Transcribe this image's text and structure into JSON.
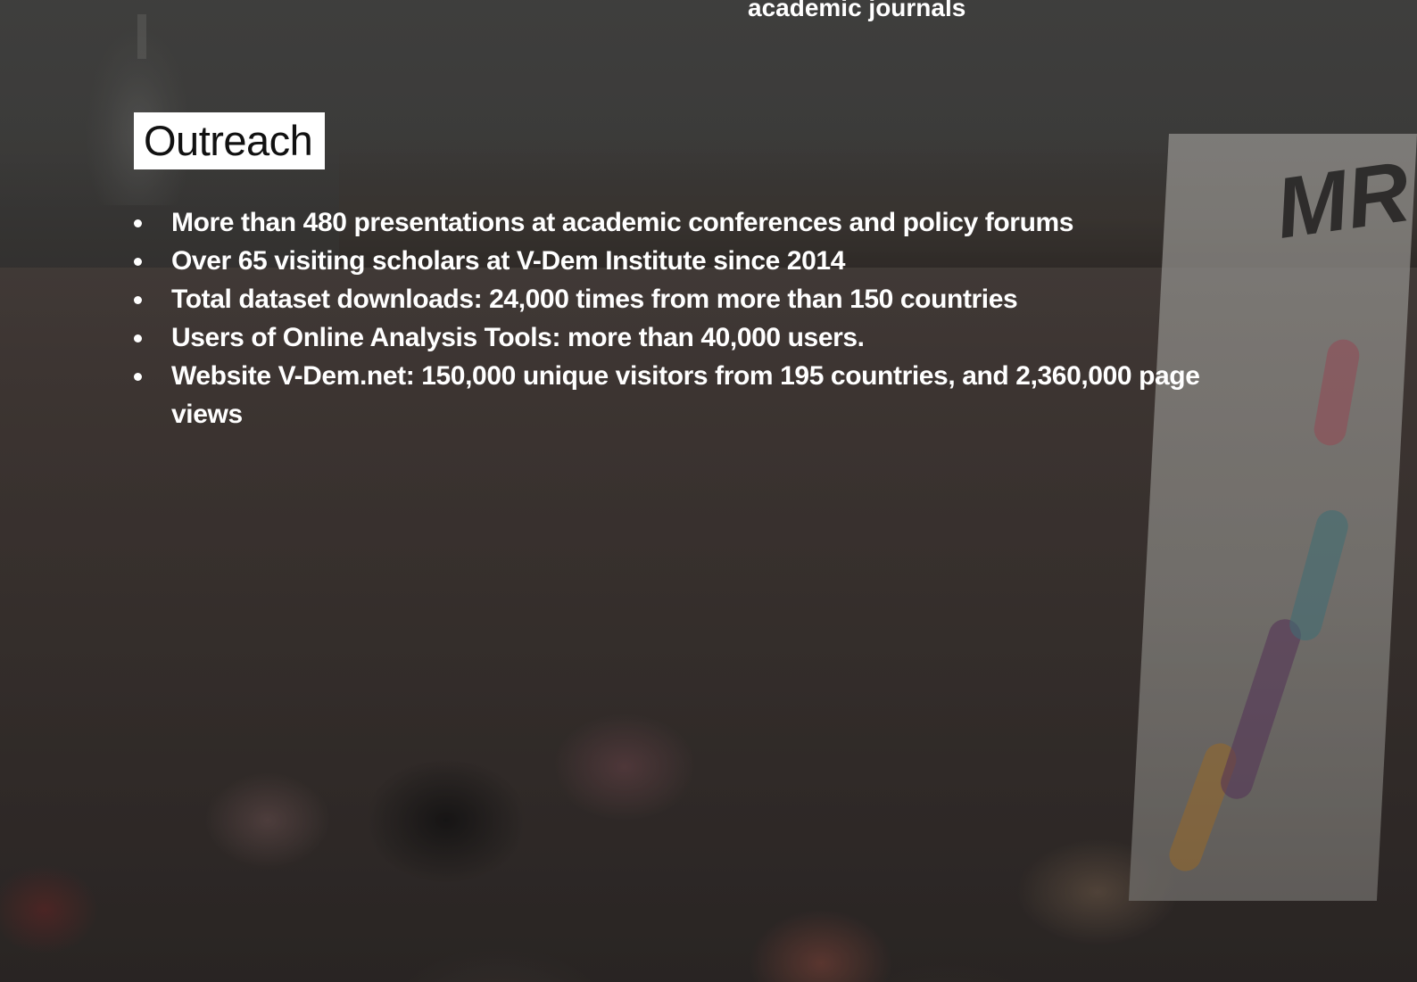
{
  "top_caption": "academic journals",
  "section": {
    "title": "Outreach"
  },
  "stats": [
    "More than 480 presentations at academic conferences and policy forums",
    "Over 65 visiting scholars at V-Dem Institute since 2014",
    "Total dataset downloads: 24,000 times from more than 150 countries",
    "Users of Online Analysis Tools: more than 40,000 users.",
    "Website V-Dem.net: 150,000 unique visitors from 195 countries, and 2,360,000 page views"
  ],
  "background": {
    "icon": "protest-crowd-photo",
    "sign_text": "MR"
  },
  "colors": {
    "text": "#ffffff",
    "title_box": "#ffffff",
    "title_text": "#111111"
  }
}
